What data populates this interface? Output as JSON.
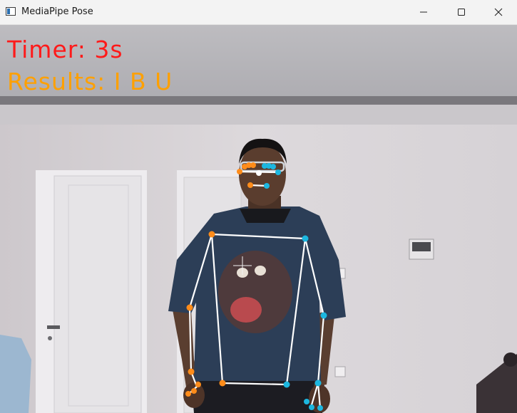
{
  "window": {
    "title": "MediaPipe Pose",
    "icon": "app-window-icon",
    "controls": [
      "minimize-icon",
      "maximize-icon",
      "close-icon"
    ]
  },
  "overlay": {
    "timer_label": "Timer:",
    "timer_value": "3s",
    "results_label": "Results:",
    "results_value": "I B U",
    "timer_color": "#ff1a1a",
    "results_color": "#ffa000"
  },
  "pose_colors": {
    "left_side": "#ff8c1a",
    "right_side": "#1cb7e0",
    "connections": "#ffffff"
  }
}
